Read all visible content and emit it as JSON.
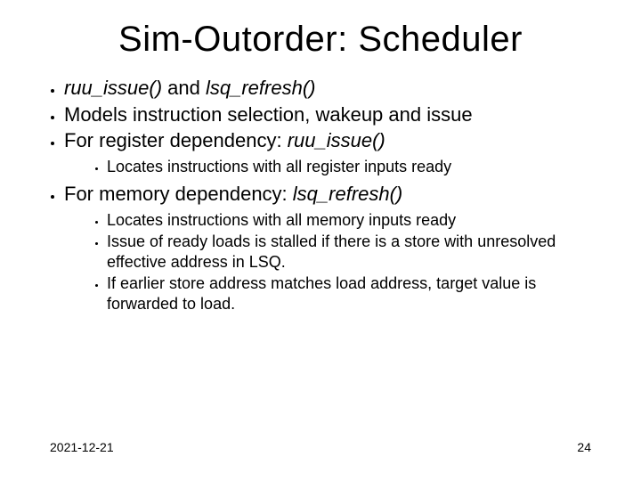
{
  "title": "Sim-Outorder: Scheduler",
  "bullets": {
    "b1_prefix": "ruu_issue()",
    "b1_mid": " and ",
    "b1_suffix": "lsq_refresh()",
    "b2": "Models instruction selection, wakeup and issue",
    "b3_prefix": "For register dependency: ",
    "b3_italic": "ruu_issue()",
    "b3_sub1": "Locates instructions with all register inputs ready",
    "b4_prefix": "For memory dependency: ",
    "b4_italic": "lsq_refresh()",
    "b4_sub1": "Locates instructions with all memory inputs ready",
    "b4_sub2": "Issue of ready loads is stalled if there is a store with unresolved effective address in LSQ.",
    "b4_sub3": "If earlier store address matches load address, target value is forwarded to load."
  },
  "footer": {
    "date": "2021-12-21",
    "page": "24"
  }
}
